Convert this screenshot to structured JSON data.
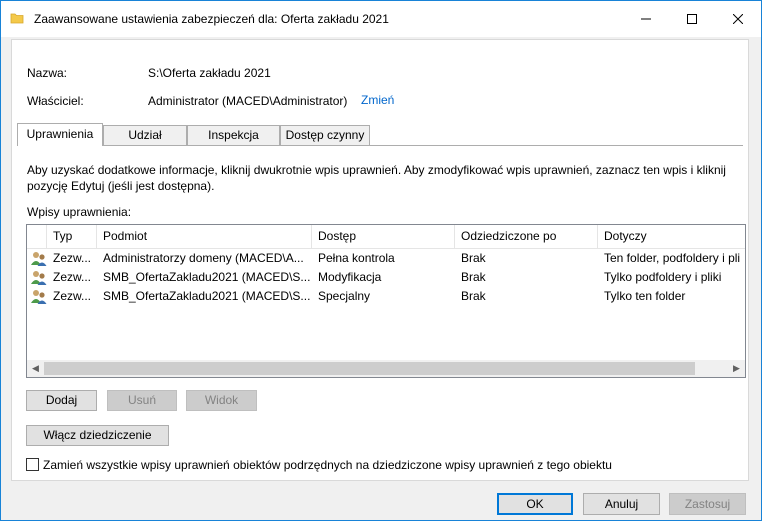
{
  "window": {
    "title": "Zaawansowane ustawienia zabezpieczeń dla: Oferta zakładu 2021"
  },
  "info": {
    "name_label": "Nazwa:",
    "name_value": "S:\\Oferta zakładu 2021",
    "owner_label": "Właściciel:",
    "owner_value": "Administrator (MACED\\Administrator)",
    "change_link": "Zmień"
  },
  "tabs": [
    {
      "label": "Uprawnienia",
      "active": true
    },
    {
      "label": "Udział",
      "active": false
    },
    {
      "label": "Inspekcja",
      "active": false
    },
    {
      "label": "Dostęp czynny",
      "active": false
    }
  ],
  "panel": {
    "description": "Aby uzyskać dodatkowe informacje, kliknij dwukrotnie wpis uprawnień. Aby zmodyfikować wpis uprawnień, zaznacz ten wpis i kliknij",
    "description2": "pozycję Edytuj (jeśli jest dostępna).",
    "entries_label": "Wpisy uprawnienia:"
  },
  "table": {
    "columns": [
      "Typ",
      "Podmiot",
      "Dostęp",
      "Odziedziczone po",
      "Dotyczy"
    ],
    "rows": [
      {
        "typ": "Zezw...",
        "podmiot": "Administratorzy domeny (MACED\\A...",
        "dostep": "Pełna kontrola",
        "odziedziczone": "Brak",
        "dotyczy": "Ten folder, podfoldery i pli"
      },
      {
        "typ": "Zezw...",
        "podmiot": "SMB_OfertaZakladu2021 (MACED\\S...",
        "dostep": "Modyfikacja",
        "odziedziczone": "Brak",
        "dotyczy": "Tylko podfoldery i pliki"
      },
      {
        "typ": "Zezw...",
        "podmiot": "SMB_OfertaZakladu2021 (MACED\\S...",
        "dostep": "Specjalny",
        "odziedziczone": "Brak",
        "dotyczy": "Tylko ten folder"
      }
    ]
  },
  "buttons": {
    "add": "Dodaj",
    "remove": "Usuń",
    "view": "Widok",
    "enable_inheritance": "Włącz dziedziczenie",
    "ok": "OK",
    "cancel": "Anuluj",
    "apply": "Zastosuj"
  },
  "checkbox": {
    "label": "Zamień wszystkie wpisy uprawnień obiektów podrzędnych na dziedziczone wpisy uprawnień z tego obiektu",
    "checked": false
  },
  "colors": {
    "accent": "#0078d7",
    "link": "#0066cc"
  }
}
